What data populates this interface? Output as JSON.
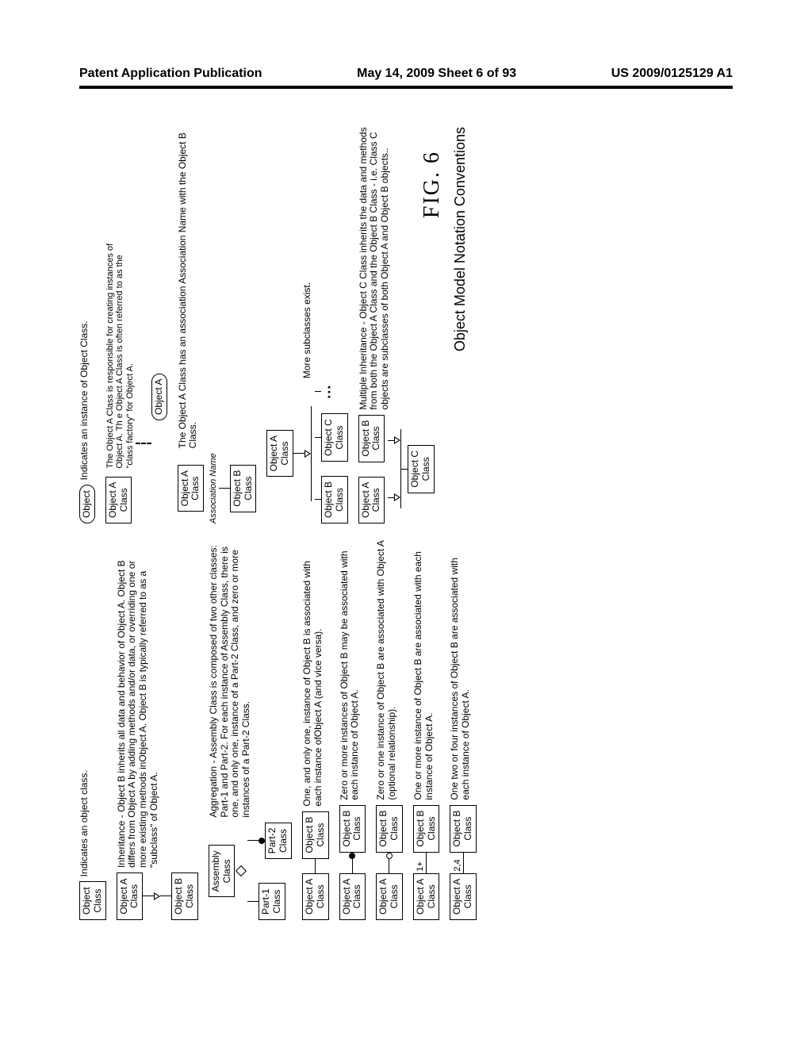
{
  "header": {
    "left": "Patent Application Publication",
    "center": "May 14, 2009  Sheet 6 of 93",
    "right": "US 2009/0125129 A1"
  },
  "figure": {
    "label": "FIG. 6",
    "caption": "Object Model Notation Conventions"
  },
  "lbl": {
    "object_class": "Object\nClass",
    "object": "Object",
    "objA_class": "Object A\nClass",
    "objA": "Object A",
    "objB_class": "Object B\nClass",
    "objB": "Object B",
    "objC_class": "Object C\nClass",
    "assembly": "Assembly\nClass",
    "part1": "Part-1\nClass",
    "part2": "Part-2\nClass",
    "assoc_name": "Association\nName"
  },
  "desc": {
    "d1": "Indicates an object class.",
    "d2": "Inheritance - Object B inherits all data and behavior of Object A. Object B differs from Object A by adding methods and/or data, or overriding one or more existing methods inObject A. Object B is typically referred to as a \"subclass\" of Object A.",
    "d3": "Aggregation - Assembly Class is composed of two other classes: Part-1 and Part-2. For each instance of Assembly Class, there is one, and only one, instance of a Part-2 Class, and zero or more instances of a Part-2 Class.",
    "d4": "One, and only one, instance of Object B is associated with each instance ofObject A (and vice versa).",
    "d5": "Zero or more instances of Object B may be associated with each instance of Object A.",
    "d6": "Zero or one instance of Object B are associated with Object A (optional relationship).",
    "d7": "One or more instance of Object B are associated with each instance of Object A.",
    "d8": "One two or four instances of Object B are associated with each instance of Object A.",
    "card1": "1+",
    "card2": "2,4",
    "r1": "Indicates an instance of Object Class.",
    "r2": "The Object A Class is responsible for creating instances of Object A. Th e Object A Class is often referred to as the \"class factory\" for Object A.",
    "r3": "The Object A Class has an association Association Name with the Object B Class.",
    "r4": "More subclasses exist.",
    "r5": "Multiple Inheritance - Object C Class inherits the data and methods from both the Object A Class and the Object B Class - i.e. Class C objects are subclasses of both Object A and Object B objects.."
  }
}
